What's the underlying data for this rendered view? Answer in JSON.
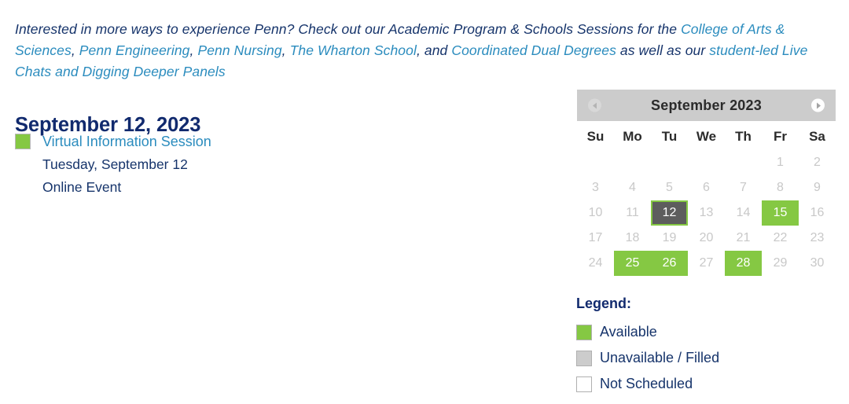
{
  "intro": {
    "segments": [
      {
        "text": "Interested in more ways to experience Penn? Check out our Academic Program & Schools Sessions for the ",
        "link": false
      },
      {
        "text": "College of Arts & Sciences",
        "link": true
      },
      {
        "text": ", ",
        "link": false
      },
      {
        "text": "Penn Engineering",
        "link": true
      },
      {
        "text": ", ",
        "link": false
      },
      {
        "text": "Penn Nursing",
        "link": true
      },
      {
        "text": ", ",
        "link": false
      },
      {
        "text": "The Wharton School",
        "link": true
      },
      {
        "text": ", and ",
        "link": false
      },
      {
        "text": "Coordinated Dual Degrees",
        "link": true
      },
      {
        "text": " as well as our ",
        "link": false
      },
      {
        "text": "student-led Live Chats and Digging Deeper Panels",
        "link": true
      }
    ]
  },
  "day": {
    "heading": "September 12, 2023",
    "events": [
      {
        "title": "Virtual Information Session",
        "date": "Tuesday, September 12",
        "location": "Online Event",
        "swatch_color": "#85c843"
      }
    ]
  },
  "calendar": {
    "title": "September 2023",
    "prev_icon": "chevron-left-icon",
    "next_icon": "chevron-right-icon",
    "weekdays": [
      "Su",
      "Mo",
      "Tu",
      "We",
      "Th",
      "Fr",
      "Sa"
    ],
    "weeks": [
      [
        {
          "label": "",
          "state": "empty"
        },
        {
          "label": "",
          "state": "empty"
        },
        {
          "label": "",
          "state": "empty"
        },
        {
          "label": "",
          "state": "empty"
        },
        {
          "label": "",
          "state": "empty"
        },
        {
          "label": "1",
          "state": "normal"
        },
        {
          "label": "2",
          "state": "normal"
        }
      ],
      [
        {
          "label": "3",
          "state": "normal"
        },
        {
          "label": "4",
          "state": "normal"
        },
        {
          "label": "5",
          "state": "normal"
        },
        {
          "label": "6",
          "state": "normal"
        },
        {
          "label": "7",
          "state": "normal"
        },
        {
          "label": "8",
          "state": "normal"
        },
        {
          "label": "9",
          "state": "normal"
        }
      ],
      [
        {
          "label": "10",
          "state": "normal"
        },
        {
          "label": "11",
          "state": "normal"
        },
        {
          "label": "12",
          "state": "selected"
        },
        {
          "label": "13",
          "state": "normal"
        },
        {
          "label": "14",
          "state": "normal"
        },
        {
          "label": "15",
          "state": "avail"
        },
        {
          "label": "16",
          "state": "normal"
        }
      ],
      [
        {
          "label": "17",
          "state": "normal"
        },
        {
          "label": "18",
          "state": "normal"
        },
        {
          "label": "19",
          "state": "normal"
        },
        {
          "label": "20",
          "state": "normal"
        },
        {
          "label": "21",
          "state": "normal"
        },
        {
          "label": "22",
          "state": "normal"
        },
        {
          "label": "23",
          "state": "normal"
        }
      ],
      [
        {
          "label": "24",
          "state": "normal"
        },
        {
          "label": "25",
          "state": "avail"
        },
        {
          "label": "26",
          "state": "avail"
        },
        {
          "label": "27",
          "state": "normal"
        },
        {
          "label": "28",
          "state": "avail"
        },
        {
          "label": "29",
          "state": "normal"
        },
        {
          "label": "30",
          "state": "normal"
        }
      ]
    ]
  },
  "legend": {
    "title": "Legend:",
    "items": [
      {
        "label": "Available",
        "color": "#85c843"
      },
      {
        "label": "Unavailable / Filled",
        "color": "#cccccc"
      },
      {
        "label": "Not Scheduled",
        "color": "#ffffff"
      }
    ]
  },
  "colors": {
    "green": "#85c843",
    "navy": "#112a6e",
    "link_blue": "#2b8cbe",
    "grey": "#cccccc",
    "selected_grey": "#5d5d5d"
  }
}
